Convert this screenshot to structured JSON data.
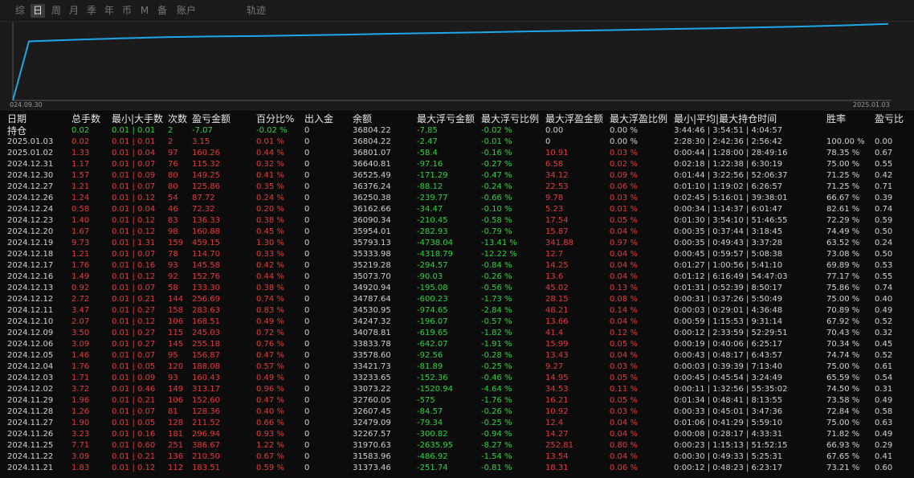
{
  "tabs": [
    {
      "label": "综",
      "active": false
    },
    {
      "label": "日",
      "active": true
    },
    {
      "label": "周",
      "active": false
    },
    {
      "label": "月",
      "active": false
    },
    {
      "label": "季",
      "active": false
    },
    {
      "label": "年",
      "active": false
    },
    {
      "label": "币",
      "active": false
    },
    {
      "label": "M",
      "active": false
    },
    {
      "label": "备",
      "active": false
    },
    {
      "label": "账户",
      "active": false
    },
    {
      "label": "轨迹",
      "active": false
    }
  ],
  "chart_data": {
    "type": "line",
    "x_start": "024.09.30",
    "x_end": "2025.01.03",
    "color": "#1ea7e8",
    "x": [
      0,
      1,
      2,
      3,
      4,
      5,
      6,
      7,
      8,
      9,
      10,
      11,
      12,
      13,
      14,
      15,
      16,
      17,
      18,
      19,
      20
    ],
    "values": [
      33500,
      36050,
      36120,
      36180,
      36230,
      36260,
      36280,
      36310,
      36340,
      36380,
      36410,
      36440,
      36480,
      36510,
      36540,
      36580,
      36610,
      36650,
      36690,
      36740,
      36804
    ],
    "ylim": [
      33500,
      36900
    ]
  },
  "colors": {
    "positive": "#e63a3a",
    "negative": "#2bd63d",
    "neutral": "#d2d2d2",
    "line": "#1ea7e8"
  },
  "headers": {
    "date_line1": "日期",
    "date_line2": "持仓",
    "total": "总手数",
    "minmax": "最小|大手数",
    "count": "次数",
    "pnl": "盈亏金额",
    "pct": "百分比%",
    "io": "出入金",
    "balance": "余额",
    "maxloss": "最大浮亏金额",
    "maxloss_pct": "最大浮亏比例",
    "maxprofit": "最大浮盈金额",
    "maxprofit_pct": "最大浮盈比例",
    "time": "最小|平均|最大持仓时间",
    "winrate": "胜率",
    "ratio": "盈亏比"
  },
  "rows": [
    {
      "date": "",
      "total": "0.02",
      "minmax": "0.01 | 0.01",
      "count": "2",
      "pnl": "-7.07",
      "pct": "-0.02 %",
      "io": "0",
      "balance": "36804.22",
      "maxloss": "-7.85",
      "maxloss_pct": "-0.02 %",
      "maxprofit": "0.00",
      "maxprofit_pct": "0.00 %",
      "time": "3:44:46 | 3:54:51 | 4:04:57",
      "winrate": "",
      "ratio": "",
      "tone": "g"
    },
    {
      "date": "2025.01.03",
      "total": "0.02",
      "minmax": "0.01 | 0.01",
      "count": "2",
      "pnl": "3.15",
      "pct": "0.01 %",
      "io": "0",
      "balance": "36804.22",
      "maxloss": "-2.47",
      "maxloss_pct": "-0.01 %",
      "maxprofit": "0",
      "maxprofit_pct": "0.00 %",
      "time": "2:28:30 | 2:42:36 | 2:56:42",
      "winrate": "100.00 %",
      "ratio": "0.00",
      "tone": "r"
    },
    {
      "date": "2025.01.02",
      "total": "1.33",
      "minmax": "0.01 | 0.04",
      "count": "97",
      "pnl": "160.26",
      "pct": "0.44 %",
      "io": "0",
      "balance": "36801.07",
      "maxloss": "-58.4",
      "maxloss_pct": "-0.16 %",
      "maxprofit": "10.91",
      "maxprofit_pct": "0.03 %",
      "time": "0:00:44 | 1:28:00 | 28:49:16",
      "winrate": "78.35 %",
      "ratio": "0.67",
      "tone": "r"
    },
    {
      "date": "2024.12.31",
      "total": "1.17",
      "minmax": "0.01 | 0.07",
      "count": "76",
      "pnl": "115.32",
      "pct": "0.32 %",
      "io": "0",
      "balance": "36640.81",
      "maxloss": "-97.16",
      "maxloss_pct": "-0.27 %",
      "maxprofit": "6.58",
      "maxprofit_pct": "0.02 %",
      "time": "0:02:18 | 1:22:38 | 6:30:19",
      "winrate": "75.00 %",
      "ratio": "0.55",
      "tone": "r"
    },
    {
      "date": "2024.12.30",
      "total": "1.57",
      "minmax": "0.01 | 0.09",
      "count": "80",
      "pnl": "149.25",
      "pct": "0.41 %",
      "io": "0",
      "balance": "36525.49",
      "maxloss": "-171.29",
      "maxloss_pct": "-0.47 %",
      "maxprofit": "34.12",
      "maxprofit_pct": "0.09 %",
      "time": "0:01:44 | 3:22:56 | 52:06:37",
      "winrate": "71.25 %",
      "ratio": "0.42",
      "tone": "r"
    },
    {
      "date": "2024.12.27",
      "total": "1.21",
      "minmax": "0.01 | 0.07",
      "count": "80",
      "pnl": "125.86",
      "pct": "0.35 %",
      "io": "0",
      "balance": "36376.24",
      "maxloss": "-88.12",
      "maxloss_pct": "-0.24 %",
      "maxprofit": "22.53",
      "maxprofit_pct": "0.06 %",
      "time": "0:01:10 | 1:19:02 | 6:26:57",
      "winrate": "71.25 %",
      "ratio": "0.71",
      "tone": "r"
    },
    {
      "date": "2024.12.26",
      "total": "1.24",
      "minmax": "0.01 | 0.12",
      "count": "54",
      "pnl": "87.72",
      "pct": "0.24 %",
      "io": "0",
      "balance": "36250.38",
      "maxloss": "-239.77",
      "maxloss_pct": "-0.66 %",
      "maxprofit": "9.78",
      "maxprofit_pct": "0.03 %",
      "time": "0:02:45 | 5:16:01 | 39:38:01",
      "winrate": "66.67 %",
      "ratio": "0.39",
      "tone": "r"
    },
    {
      "date": "2024.12.24",
      "total": "0.58",
      "minmax": "0.01 | 0.04",
      "count": "46",
      "pnl": "72.32",
      "pct": "0.20 %",
      "io": "0",
      "balance": "36162.66",
      "maxloss": "-34.47",
      "maxloss_pct": "-0.10 %",
      "maxprofit": "5.23",
      "maxprofit_pct": "0.01 %",
      "time": "0:00:34 | 1:14:37 | 6:01:47",
      "winrate": "82.61 %",
      "ratio": "0.74",
      "tone": "r"
    },
    {
      "date": "2024.12.23",
      "total": "1.40",
      "minmax": "0.01 | 0.12",
      "count": "83",
      "pnl": "136.33",
      "pct": "0.38 %",
      "io": "0",
      "balance": "36090.34",
      "maxloss": "-210.45",
      "maxloss_pct": "-0.58 %",
      "maxprofit": "17.54",
      "maxprofit_pct": "0.05 %",
      "time": "0:01:30 | 3:54:10 | 51:46:55",
      "winrate": "72.29 %",
      "ratio": "0.59",
      "tone": "r"
    },
    {
      "date": "2024.12.20",
      "total": "1.67",
      "minmax": "0.01 | 0.12",
      "count": "98",
      "pnl": "160.88",
      "pct": "0.45 %",
      "io": "0",
      "balance": "35954.01",
      "maxloss": "-282.93",
      "maxloss_pct": "-0.79 %",
      "maxprofit": "15.87",
      "maxprofit_pct": "0.04 %",
      "time": "0:00:35 | 0:37:44 | 3:18:45",
      "winrate": "74.49 %",
      "ratio": "0.50",
      "tone": "r"
    },
    {
      "date": "2024.12.19",
      "total": "9.73",
      "minmax": "0.01 | 1.31",
      "count": "159",
      "pnl": "459.15",
      "pct": "1.30 %",
      "io": "0",
      "balance": "35793.13",
      "maxloss": "-4738.04",
      "maxloss_pct": "-13.41 %",
      "maxprofit": "341.88",
      "maxprofit_pct": "0.97 %",
      "time": "0:00:35 | 0:49:43 | 3:37:28",
      "winrate": "63.52 %",
      "ratio": "0.24",
      "tone": "r"
    },
    {
      "date": "2024.12.18",
      "total": "1.21",
      "minmax": "0.01 | 0.07",
      "count": "78",
      "pnl": "114.70",
      "pct": "0.33 %",
      "io": "0",
      "balance": "35333.98",
      "maxloss": "-4318.79",
      "maxloss_pct": "-12.22 %",
      "maxprofit": "12.7",
      "maxprofit_pct": "0.04 %",
      "time": "0:00:45 | 0:59:57 | 5:08:38",
      "winrate": "73.08 %",
      "ratio": "0.50",
      "tone": "r"
    },
    {
      "date": "2024.12.17",
      "total": "1.76",
      "minmax": "0.01 | 0.16",
      "count": "93",
      "pnl": "145.58",
      "pct": "0.42 %",
      "io": "0",
      "balance": "35219.28",
      "maxloss": "-294.57",
      "maxloss_pct": "-0.84 %",
      "maxprofit": "14.25",
      "maxprofit_pct": "0.04 %",
      "time": "0:01:27 | 1:00:56 | 5:41:10",
      "winrate": "69.89 %",
      "ratio": "0.53",
      "tone": "r"
    },
    {
      "date": "2024.12.16",
      "total": "1.49",
      "minmax": "0.01 | 0.12",
      "count": "92",
      "pnl": "152.76",
      "pct": "0.44 %",
      "io": "0",
      "balance": "35073.70",
      "maxloss": "-90.03",
      "maxloss_pct": "-0.26 %",
      "maxprofit": "13.6",
      "maxprofit_pct": "0.04 %",
      "time": "0:01:12 | 6:16:49 | 54:47:03",
      "winrate": "77.17 %",
      "ratio": "0.55",
      "tone": "r"
    },
    {
      "date": "2024.12.13",
      "total": "0.92",
      "minmax": "0.01 | 0.07",
      "count": "58",
      "pnl": "133.30",
      "pct": "0.38 %",
      "io": "0",
      "balance": "34920.94",
      "maxloss": "-195.08",
      "maxloss_pct": "-0.56 %",
      "maxprofit": "45.02",
      "maxprofit_pct": "0.13 %",
      "time": "0:01:31 | 0:52:39 | 8:50:17",
      "winrate": "75.86 %",
      "ratio": "0.74",
      "tone": "r"
    },
    {
      "date": "2024.12.12",
      "total": "2.72",
      "minmax": "0.01 | 0.21",
      "count": "144",
      "pnl": "256.69",
      "pct": "0.74 %",
      "io": "0",
      "balance": "34787.64",
      "maxloss": "-600.23",
      "maxloss_pct": "-1.73 %",
      "maxprofit": "28.15",
      "maxprofit_pct": "0.08 %",
      "time": "0:00:31 | 0:37:26 | 5:50:49",
      "winrate": "75.00 %",
      "ratio": "0.40",
      "tone": "r"
    },
    {
      "date": "2024.12.11",
      "total": "3.47",
      "minmax": "0.01 | 0.27",
      "count": "158",
      "pnl": "283.63",
      "pct": "0.83 %",
      "io": "0",
      "balance": "34530.95",
      "maxloss": "-974.65",
      "maxloss_pct": "-2.84 %",
      "maxprofit": "48.21",
      "maxprofit_pct": "0.14 %",
      "time": "0:00:03 | 0:29:01 | 4:36:48",
      "winrate": "70.89 %",
      "ratio": "0.49",
      "tone": "r"
    },
    {
      "date": "2024.12.10",
      "total": "2.07",
      "minmax": "0.01 | 0.12",
      "count": "106",
      "pnl": "168.51",
      "pct": "0.49 %",
      "io": "0",
      "balance": "34247.32",
      "maxloss": "-196.07",
      "maxloss_pct": "-0.57 %",
      "maxprofit": "13.66",
      "maxprofit_pct": "0.04 %",
      "time": "0:00:59 | 1:15:53 | 9:31:14",
      "winrate": "67.92 %",
      "ratio": "0.52",
      "tone": "r"
    },
    {
      "date": "2024.12.09",
      "total": "3.50",
      "minmax": "0.01 | 0.27",
      "count": "115",
      "pnl": "245.03",
      "pct": "0.72 %",
      "io": "0",
      "balance": "34078.81",
      "maxloss": "-619.65",
      "maxloss_pct": "-1.82 %",
      "maxprofit": "41.4",
      "maxprofit_pct": "0.12 %",
      "time": "0:00:12 | 2:33:59 | 52:29:51",
      "winrate": "70.43 %",
      "ratio": "0.32",
      "tone": "r"
    },
    {
      "date": "2024.12.06",
      "total": "3.09",
      "minmax": "0.01 | 0.27",
      "count": "145",
      "pnl": "255.18",
      "pct": "0.76 %",
      "io": "0",
      "balance": "33833.78",
      "maxloss": "-642.07",
      "maxloss_pct": "-1.91 %",
      "maxprofit": "15.99",
      "maxprofit_pct": "0.05 %",
      "time": "0:00:19 | 0:40:06 | 6:25:17",
      "winrate": "70.34 %",
      "ratio": "0.45",
      "tone": "r"
    },
    {
      "date": "2024.12.05",
      "total": "1.46",
      "minmax": "0.01 | 0.07",
      "count": "95",
      "pnl": "156.87",
      "pct": "0.47 %",
      "io": "0",
      "balance": "33578.60",
      "maxloss": "-92.56",
      "maxloss_pct": "-0.28 %",
      "maxprofit": "13.43",
      "maxprofit_pct": "0.04 %",
      "time": "0:00:43 | 0:48:17 | 6:43:57",
      "winrate": "74.74 %",
      "ratio": "0.52",
      "tone": "r"
    },
    {
      "date": "2024.12.04",
      "total": "1.76",
      "minmax": "0.01 | 0.05",
      "count": "120",
      "pnl": "188.08",
      "pct": "0.57 %",
      "io": "0",
      "balance": "33421.73",
      "maxloss": "-81.89",
      "maxloss_pct": "-0.25 %",
      "maxprofit": "9.27",
      "maxprofit_pct": "0.03 %",
      "time": "0:00:03 | 0:39:39 | 7:13:40",
      "winrate": "75.00 %",
      "ratio": "0.61",
      "tone": "r"
    },
    {
      "date": "2024.12.03",
      "total": "1.71",
      "minmax": "0.01 | 0.09",
      "count": "93",
      "pnl": "160.43",
      "pct": "0.49 %",
      "io": "0",
      "balance": "33233.65",
      "maxloss": "-152.36",
      "maxloss_pct": "-0.46 %",
      "maxprofit": "14.95",
      "maxprofit_pct": "0.05 %",
      "time": "0:00:45 | 0:45:54 | 3:24:49",
      "winrate": "65.59 %",
      "ratio": "0.54",
      "tone": "r"
    },
    {
      "date": "2024.12.02",
      "total": "3.72",
      "minmax": "0.01 | 0.46",
      "count": "149",
      "pnl": "313.17",
      "pct": "0.96 %",
      "io": "0",
      "balance": "33073.22",
      "maxloss": "-1520.94",
      "maxloss_pct": "-4.64 %",
      "maxprofit": "34.53",
      "maxprofit_pct": "0.11 %",
      "time": "0:00:11 | 1:32:56 | 55:35:02",
      "winrate": "74.50 %",
      "ratio": "0.31",
      "tone": "r"
    },
    {
      "date": "2024.11.29",
      "total": "1.96",
      "minmax": "0.01 | 0.21",
      "count": "106",
      "pnl": "152.60",
      "pct": "0.47 %",
      "io": "0",
      "balance": "32760.05",
      "maxloss": "-575",
      "maxloss_pct": "-1.76 %",
      "maxprofit": "16.21",
      "maxprofit_pct": "0.05 %",
      "time": "0:01:34 | 0:48:41 | 8:13:55",
      "winrate": "73.58 %",
      "ratio": "0.49",
      "tone": "r"
    },
    {
      "date": "2024.11.28",
      "total": "1.26",
      "minmax": "0.01 | 0.07",
      "count": "81",
      "pnl": "128.36",
      "pct": "0.40 %",
      "io": "0",
      "balance": "32607.45",
      "maxloss": "-84.57",
      "maxloss_pct": "-0.26 %",
      "maxprofit": "10.92",
      "maxprofit_pct": "0.03 %",
      "time": "0:00:33 | 0:45:01 | 3:47:36",
      "winrate": "72.84 %",
      "ratio": "0.58",
      "tone": "r"
    },
    {
      "date": "2024.11.27",
      "total": "1.90",
      "minmax": "0.01 | 0.05",
      "count": "128",
      "pnl": "211.52",
      "pct": "0.66 %",
      "io": "0",
      "balance": "32479.09",
      "maxloss": "-79.34",
      "maxloss_pct": "-0.25 %",
      "maxprofit": "12.4",
      "maxprofit_pct": "0.04 %",
      "time": "0:01:06 | 0:41:29 | 5:59:10",
      "winrate": "75.00 %",
      "ratio": "0.63",
      "tone": "r"
    },
    {
      "date": "2024.11.26",
      "total": "3.23",
      "minmax": "0.01 | 0.16",
      "count": "181",
      "pnl": "296.94",
      "pct": "0.93 %",
      "io": "0",
      "balance": "32267.57",
      "maxloss": "-300.82",
      "maxloss_pct": "-0.94 %",
      "maxprofit": "14.27",
      "maxprofit_pct": "0.04 %",
      "time": "0:00:08 | 0:28:17 | 4:33:31",
      "winrate": "71.82 %",
      "ratio": "0.49",
      "tone": "r"
    },
    {
      "date": "2024.11.25",
      "total": "7.71",
      "minmax": "0.01 | 0.60",
      "count": "251",
      "pnl": "386.67",
      "pct": "1.22 %",
      "io": "0",
      "balance": "31970.63",
      "maxloss": "-2635.95",
      "maxloss_pct": "-8.27 %",
      "maxprofit": "252.81",
      "maxprofit_pct": "0.80 %",
      "time": "0:00:23 | 1:15:13 | 51:52:15",
      "winrate": "66.93 %",
      "ratio": "0.29",
      "tone": "r"
    },
    {
      "date": "2024.11.22",
      "total": "3.09",
      "minmax": "0.01 | 0.21",
      "count": "136",
      "pnl": "210.50",
      "pct": "0.67 %",
      "io": "0",
      "balance": "31583.96",
      "maxloss": "-486.92",
      "maxloss_pct": "-1.54 %",
      "maxprofit": "13.54",
      "maxprofit_pct": "0.04 %",
      "time": "0:00:30 | 0:49:33 | 5:25:31",
      "winrate": "67.65 %",
      "ratio": "0.41",
      "tone": "r"
    },
    {
      "date": "2024.11.21",
      "total": "1.83",
      "minmax": "0.01 | 0.12",
      "count": "112",
      "pnl": "183.51",
      "pct": "0.59 %",
      "io": "0",
      "balance": "31373.46",
      "maxloss": "-251.74",
      "maxloss_pct": "-0.81 %",
      "maxprofit": "18.31",
      "maxprofit_pct": "0.06 %",
      "time": "0:00:12 | 0:48:23 | 6:23:17",
      "winrate": "73.21 %",
      "ratio": "0.60",
      "tone": "r"
    }
  ]
}
